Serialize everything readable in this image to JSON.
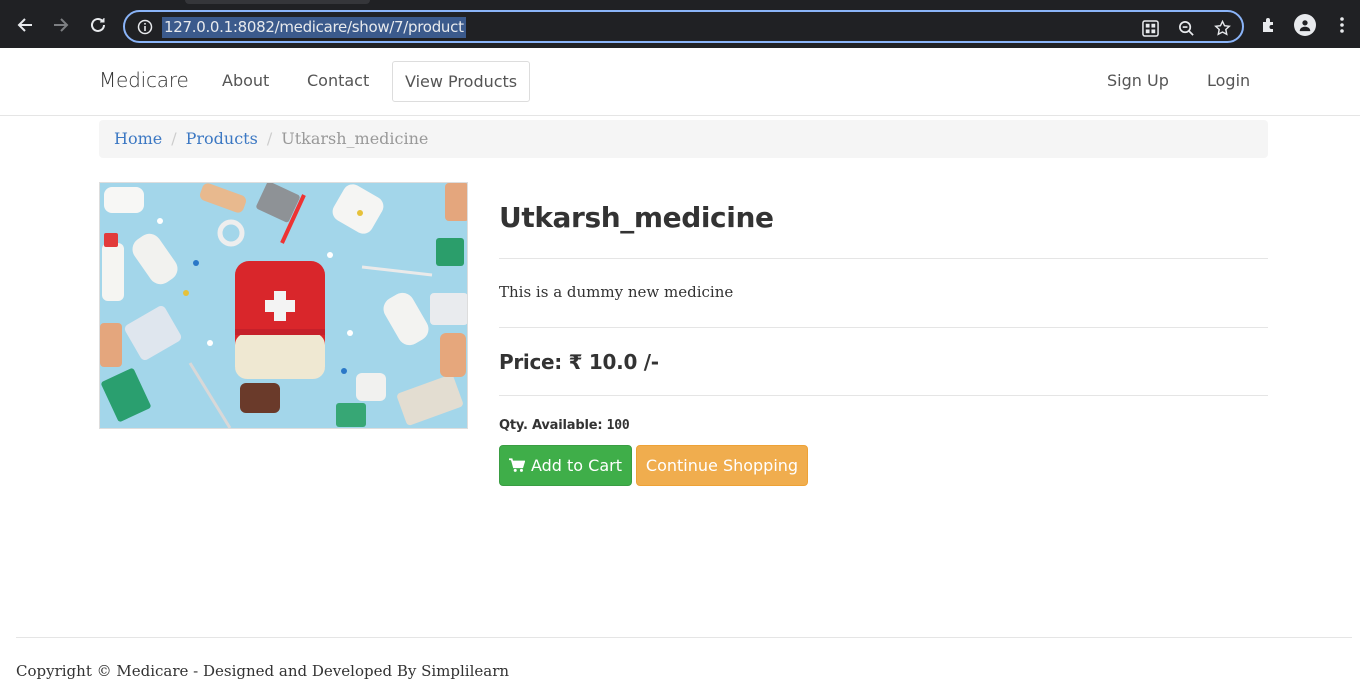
{
  "browser": {
    "url": "127.0.0.1:8082/medicare/show/7/product"
  },
  "navbar": {
    "brand": "Medicare",
    "links": [
      "About",
      "Contact",
      "View Products"
    ],
    "right_links": [
      "Sign Up",
      "Login"
    ]
  },
  "breadcrumb": {
    "home": "Home",
    "products": "Products",
    "current": "Utkarsh_medicine"
  },
  "product": {
    "image_icon": "first-aid-kit-photo",
    "title": "Utkarsh_medicine",
    "description": "This is a dummy new medicine",
    "price": "Price: ₹ 10.0 /-",
    "qty_label": "Qty. Available: ",
    "qty_value": "100",
    "add_to_cart_label": "Add to Cart",
    "continue_label": "Continue Shopping"
  },
  "footer": {
    "text": "Copyright © Medicare - Designed and Developed By Simplilearn"
  },
  "colors": {
    "success": "#3fae49",
    "warning": "#f0ad4e",
    "link": "#3c78c3"
  }
}
